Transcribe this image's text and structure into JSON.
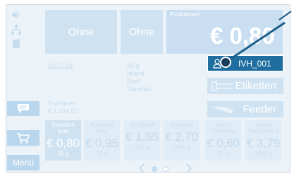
{
  "tiles": {
    "left": "Ohne",
    "middle": "Ohne"
  },
  "product_value": {
    "label": "Produktwert",
    "amount": "€ 0,80"
  },
  "info": {
    "date": "10.12.19",
    "weight": "20 g",
    "region": "Inland",
    "type": "Brief",
    "service": "Standard",
    "credit_label": "Guthaben",
    "credit_value": "€ 1.234,50"
  },
  "user_button": {
    "label": "IVH_001",
    "icon": "person-icon"
  },
  "buttons": {
    "labels": "Etiketten",
    "feeder": "Feeder"
  },
  "sidebar": {
    "menu_label": "Menü"
  },
  "products": [
    {
      "name": "Standard\nbrief",
      "price": "€ 0,80",
      "weight": "20 g"
    },
    {
      "name": "Kompakt\nbrief",
      "price": "€ 0,95",
      "weight": "50 g"
    },
    {
      "name": "Großbrief",
      "price": "€ 1,55",
      "weight": "500 g"
    },
    {
      "name": "Maxibrief",
      "price": "€ 2,70",
      "weight": "1000 g"
    },
    {
      "name": "Inland\nPostkarte",
      "price": "€ 0,60",
      "weight": "15 g"
    },
    {
      "name": "Inland\nPäckchen S",
      "price": "€ 3,79",
      "weight": "2000 g"
    }
  ],
  "colors": {
    "accent": "#1f6e9f",
    "tile": "#cfe2f1",
    "background": "#ebf2f8"
  }
}
